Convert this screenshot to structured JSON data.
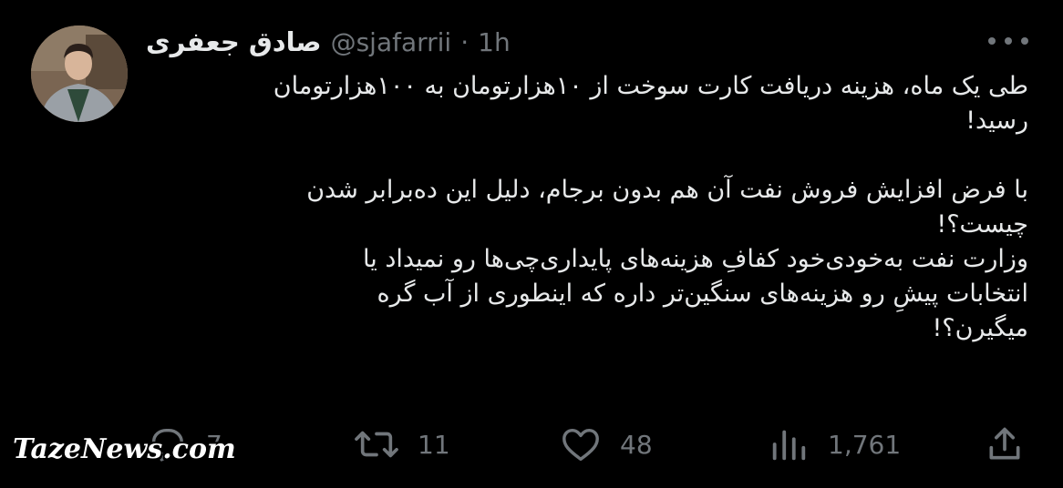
{
  "author": {
    "name": "صادق جعفری",
    "handle": "@sjafarrii",
    "separator": "·",
    "time": "1h"
  },
  "tweet": {
    "paragraph1_line1": "طی یک ماه، هزینه دریافت کارت سوخت از ۱۰هزارتومان به ۱۰۰هزارتومان",
    "paragraph1_line2": "رسید!",
    "paragraph2_line1": "با فرض افزایش فروش نفت آن هم بدون برجام، دلیل این ده‌برابر شدن",
    "paragraph2_line2": "چیست؟!",
    "paragraph2_line3": "وزارت نفت به‌خودی‌خود کفافِ هزینه‌های پایداری‌چی‌ها رو نمیداد یا",
    "paragraph2_line4": "انتخابات پیشِ رو هزینه‌های سنگین‌تر داره که اینطوری از آب گره",
    "paragraph2_line5": "میگیرن؟!"
  },
  "actions": {
    "replies": "7",
    "retweets": "11",
    "likes": "48",
    "views": "1,761"
  },
  "icons": {
    "reply": "reply-icon",
    "retweet": "retweet-icon",
    "like": "heart-icon",
    "views": "views-icon",
    "share": "share-icon",
    "more": "more-icon"
  },
  "watermark": "TazeNews.com",
  "colors": {
    "background": "#000000",
    "text": "#e7e9ea",
    "secondary": "#71767b"
  }
}
